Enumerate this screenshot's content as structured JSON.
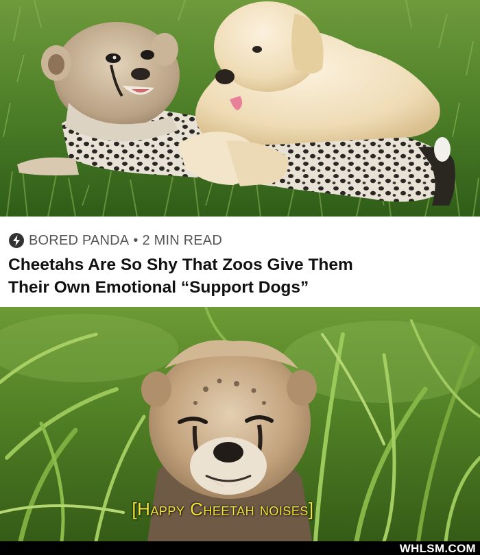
{
  "top_photo": {
    "icon": "cheetah-cub-and-puppy-photo"
  },
  "article": {
    "source_icon": "bolt-icon",
    "source": "BORED PANDA",
    "separator": "•",
    "read_time": "2 MIN READ",
    "headline_line1": "Cheetahs Are So Shy That Zoos Give Them",
    "headline_line2": "Their Own Emotional “Support Dogs”"
  },
  "bottom_photo": {
    "icon": "happy-cheetah-cub-photo",
    "subtitle": "[Happy Cheetah noises]"
  },
  "watermark": "WHLSM.COM",
  "colors": {
    "subtitle": "#f2e33a",
    "headline": "#111111",
    "source": "#555555"
  }
}
